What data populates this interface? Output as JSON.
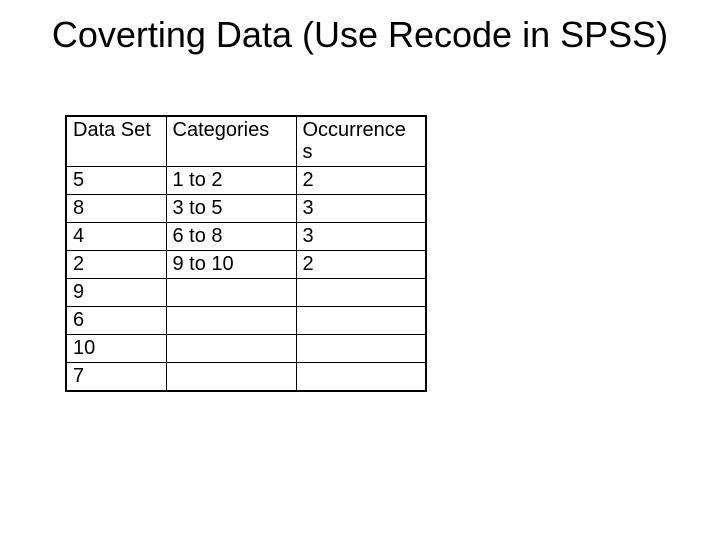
{
  "title": "Coverting Data (Use Recode in SPSS)",
  "headers": {
    "c1": "Data Set",
    "c2": "Categories",
    "c3_line1": "Occurrence",
    "c3_line2": "s"
  },
  "rows": [
    {
      "data_set": "5",
      "category": "1 to 2",
      "occur": "2"
    },
    {
      "data_set": "8",
      "category": "3 to 5",
      "occur": "3"
    },
    {
      "data_set": "4",
      "category": "6 to 8",
      "occur": "3"
    },
    {
      "data_set": "2",
      "category": "9 to 10",
      "occur": "2"
    },
    {
      "data_set": "9",
      "category": "",
      "occur": ""
    },
    {
      "data_set": "6",
      "category": "",
      "occur": ""
    },
    {
      "data_set": "10",
      "category": "",
      "occur": ""
    },
    {
      "data_set": "7",
      "category": "",
      "occur": ""
    }
  ]
}
